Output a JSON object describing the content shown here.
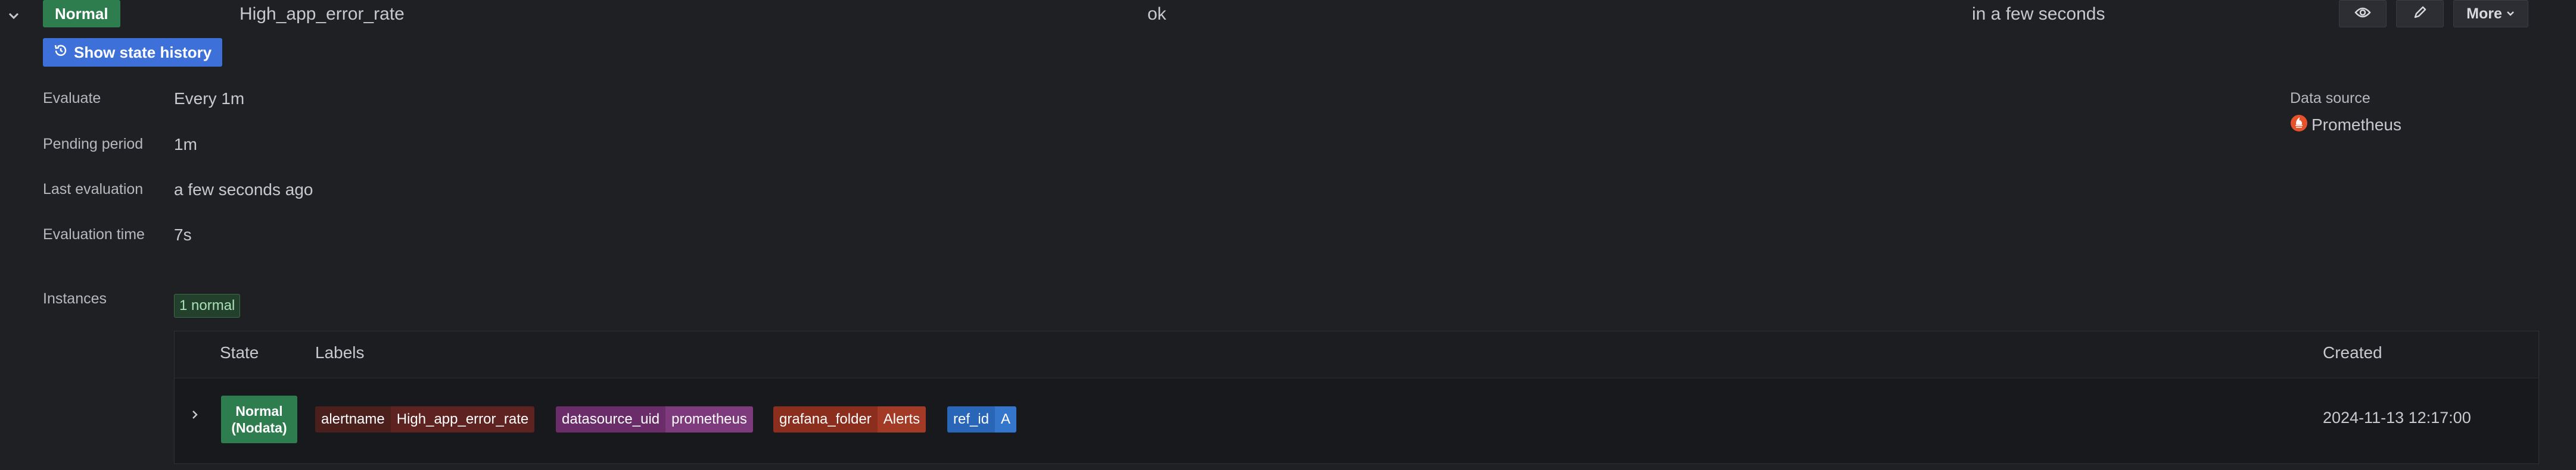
{
  "rule": {
    "state": "Normal",
    "name": "High_app_error_rate",
    "health": "ok",
    "next_evaluation": "in a few seconds",
    "more_label": "More"
  },
  "history_button": "Show state history",
  "details": [
    {
      "label": "Evaluate",
      "value": "Every 1m"
    },
    {
      "label": "Pending period",
      "value": "1m"
    },
    {
      "label": "Last evaluation",
      "value": "a few seconds ago"
    },
    {
      "label": "Evaluation time",
      "value": "7s"
    }
  ],
  "datasource": {
    "label": "Data source",
    "name": "Prometheus"
  },
  "instances": {
    "label": "Instances",
    "summary_badge": "1 normal",
    "columns": [
      "State",
      "Labels",
      "Created"
    ],
    "rows": [
      {
        "state_line1": "Normal",
        "state_line2": "(Nodata)",
        "labels": [
          {
            "key": "alertname",
            "value": "High_app_error_rate"
          },
          {
            "key": "datasource_uid",
            "value": "prometheus"
          },
          {
            "key": "grafana_folder",
            "value": "Alerts"
          },
          {
            "key": "ref_id",
            "value": "A"
          }
        ],
        "created": "2024-11-13 12:17:00"
      }
    ]
  },
  "colors": {
    "background": "#1f2024",
    "normal_green": "#2e7d4f",
    "primary_blue": "#3d71d9",
    "prometheus_orange": "#e6522c"
  }
}
